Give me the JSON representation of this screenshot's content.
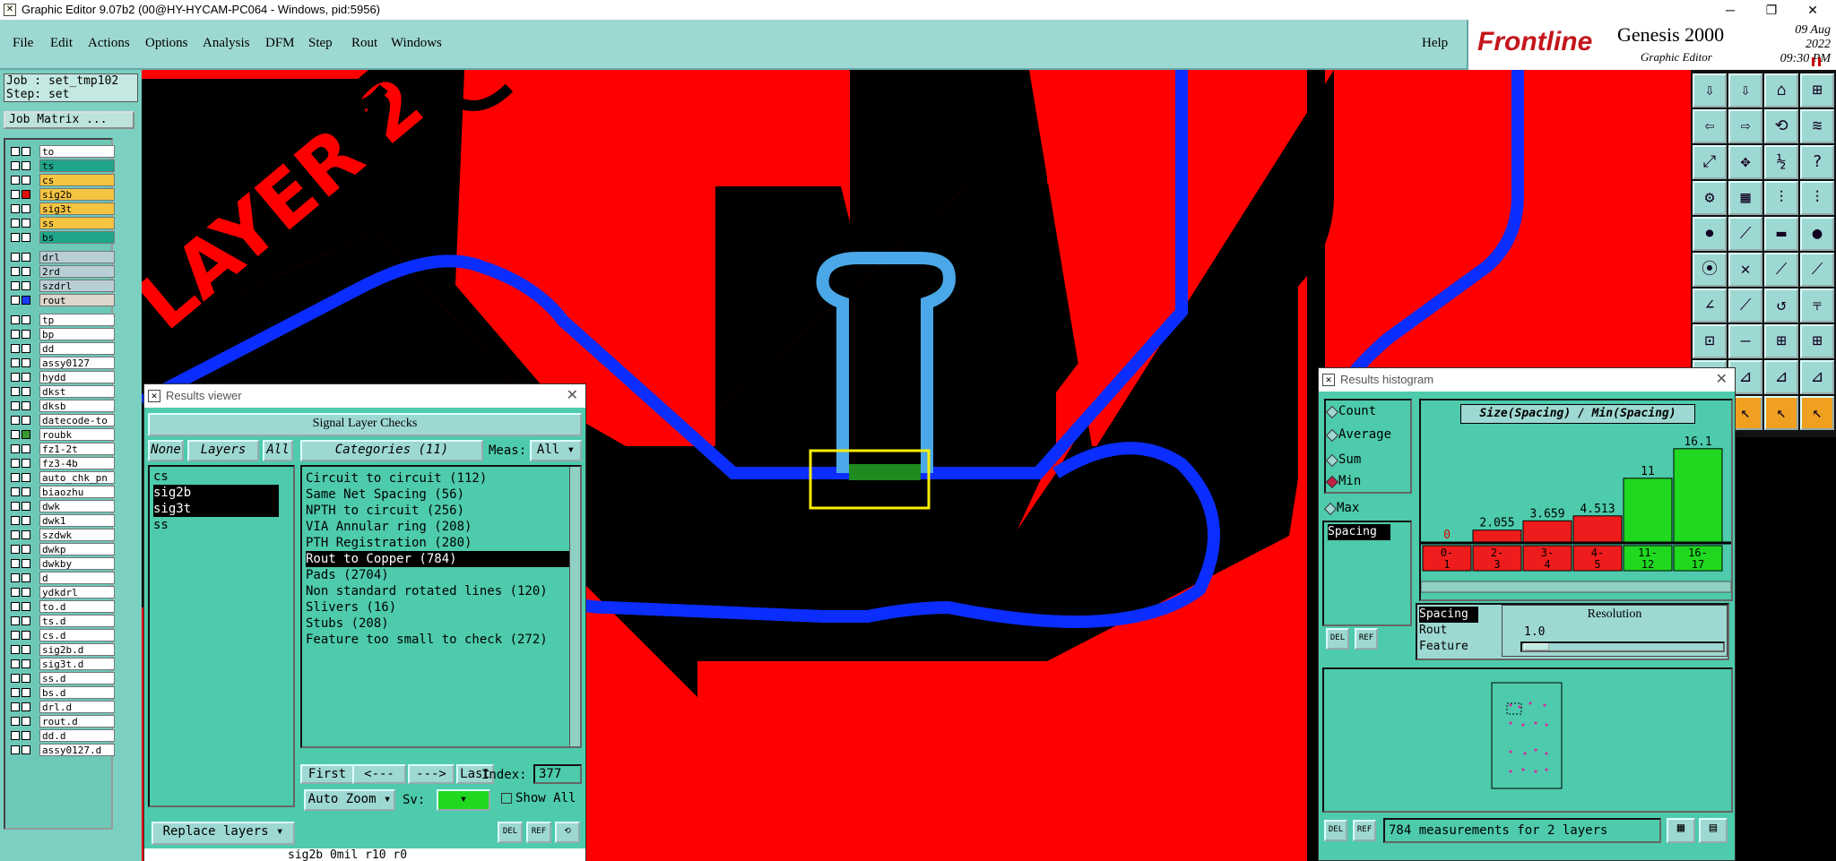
{
  "window": {
    "title": "Graphic Editor 9.07b2 (00@HY-HYCAM-PC064 - Windows, pid:5956)",
    "minimize": "─",
    "maximize": "❐",
    "close": "✕"
  },
  "menu": {
    "items": [
      "File",
      "Edit",
      "Actions",
      "Options",
      "Analysis",
      "DFM",
      "Step",
      "Rout",
      "Windows"
    ],
    "help": "Help"
  },
  "brand": {
    "logo": "Frontline",
    "product": "Genesis 2000",
    "subtitle": "Graphic Editor",
    "date": "09 Aug 2022",
    "time": "09:30 PM"
  },
  "job": {
    "job_line": "Job : set_tmp102",
    "step_line": "Step: set",
    "matrix_button": "Job Matrix ..."
  },
  "layers": [
    {
      "name": "to",
      "color": "#ffffff"
    },
    {
      "name": "ts",
      "color": "#1fa58a"
    },
    {
      "name": "cs",
      "color": "#f5c542"
    },
    {
      "name": "sig2b",
      "color": "#f5c542",
      "highlight": true
    },
    {
      "name": "sig3t",
      "color": "#f5c542"
    },
    {
      "name": "ss",
      "color": "#f5c542"
    },
    {
      "name": "bs",
      "color": "#1fa58a"
    },
    {
      "name": "drl",
      "color": "#b9cfd6"
    },
    {
      "name": "2rd",
      "color": "#b9cfd6"
    },
    {
      "name": "szdrl",
      "color": "#b9cfd6"
    },
    {
      "name": "rout",
      "color": "#ddd7cc",
      "highlight": true
    },
    {
      "name": "tp",
      "color": "#ffffff"
    },
    {
      "name": "bp",
      "color": "#ffffff"
    },
    {
      "name": "dd",
      "color": "#ffffff"
    },
    {
      "name": "assy0127",
      "color": "#ffffff"
    },
    {
      "name": "hydd",
      "color": "#ffffff"
    },
    {
      "name": "dkst",
      "color": "#ffffff"
    },
    {
      "name": "dksb",
      "color": "#ffffff"
    },
    {
      "name": "datecode-to",
      "color": "#ffffff"
    },
    {
      "name": "roubk",
      "color": "#ffffff",
      "green": true
    },
    {
      "name": "fz1-2t",
      "color": "#ffffff"
    },
    {
      "name": "fz3-4b",
      "color": "#ffffff"
    },
    {
      "name": "auto_chk_pn",
      "color": "#ffffff"
    },
    {
      "name": "biaozhu",
      "color": "#ffffff"
    },
    {
      "name": "dwk",
      "color": "#ffffff"
    },
    {
      "name": "dwk1",
      "color": "#ffffff"
    },
    {
      "name": "szdwk",
      "color": "#ffffff"
    },
    {
      "name": "dwkp",
      "color": "#ffffff"
    },
    {
      "name": "dwkby",
      "color": "#ffffff"
    },
    {
      "name": "d",
      "color": "#ffffff"
    },
    {
      "name": "ydkdrl",
      "color": "#ffffff"
    },
    {
      "name": "to.d",
      "color": "#ffffff"
    },
    {
      "name": "ts.d",
      "color": "#ffffff"
    },
    {
      "name": "cs.d",
      "color": "#ffffff"
    },
    {
      "name": "sig2b.d",
      "color": "#ffffff"
    },
    {
      "name": "sig3t.d",
      "color": "#ffffff"
    },
    {
      "name": "ss.d",
      "color": "#ffffff"
    },
    {
      "name": "bs.d",
      "color": "#ffffff"
    },
    {
      "name": "drl.d",
      "color": "#ffffff"
    },
    {
      "name": "rout.d",
      "color": "#ffffff"
    },
    {
      "name": "dd.d",
      "color": "#ffffff"
    },
    {
      "name": "assy0127.d",
      "color": "#ffffff"
    }
  ],
  "canvas": {
    "board_text": "LAYER 2"
  },
  "results_viewer": {
    "title": "Results viewer",
    "header": "Signal Layer Checks",
    "none_btn": "None",
    "layers_btn": "Layers",
    "all_btn": "All",
    "categories_label": "Categories (11)",
    "meas_label": "Meas:",
    "meas_value": "All",
    "layers": [
      "cs",
      "sig2b",
      "sig3t",
      "ss"
    ],
    "selected_layers": [
      "sig2b",
      "sig3t"
    ],
    "categories": [
      "Circuit to circuit (112)",
      "Same Net Spacing (56)",
      "NPTH to circuit (256)",
      "VIA Annular ring (208)",
      "PTH Registration (280)",
      "Rout to Copper (784)",
      "Pads (2704)",
      "Non standard rotated lines (120)",
      "Slivers (16)",
      "Stubs (208)",
      "Feature too small to check (272)"
    ],
    "selected_category": "Rout to Copper (784)",
    "first": "First",
    "prev": "<---",
    "next": "--->",
    "last": "Last",
    "index_label": "Index:",
    "index_value": "377",
    "auto_zoom": "Auto Zoom",
    "sv_label": "Sv:",
    "show_all": "Show All",
    "replace_layers": "Replace layers",
    "status": "sig2b 0mil  r10  r0"
  },
  "histogram": {
    "title": "Results histogram",
    "options": [
      "Count",
      "Average",
      "Sum",
      "Min",
      "Max"
    ],
    "selected_option": "Min",
    "chart_title": "Size(Spacing) / Min(Spacing)",
    "side_list": [
      "Spacing"
    ],
    "bins": [
      "0-1",
      "2-3",
      "3-4",
      "4-5",
      "11-12",
      "16-17"
    ],
    "bin_colors": [
      "#ee1c1c",
      "#ee1c1c",
      "#ee1c1c",
      "#ee1c1c",
      "#1fd81f",
      "#1fd81f"
    ],
    "types": [
      "Spacing",
      "Rout",
      "Feature"
    ],
    "resolution_label": "Resolution",
    "resolution_value": "1.0",
    "summary": "784 measurements for 2 layers",
    "del": "DEL",
    "ref": "REF"
  },
  "chart_data": {
    "type": "bar",
    "title": "Size(Spacing) / Min(Spacing)",
    "categories": [
      "0-1",
      "2-3",
      "3-4",
      "4-5",
      "11-12",
      "16-17"
    ],
    "values": [
      0,
      2.055,
      3.659,
      4.513,
      11,
      16.1
    ],
    "value_labels": [
      "0",
      "2.055",
      "3.659",
      "4.513",
      "11",
      "16.1"
    ],
    "ylim": [
      0,
      17
    ]
  }
}
